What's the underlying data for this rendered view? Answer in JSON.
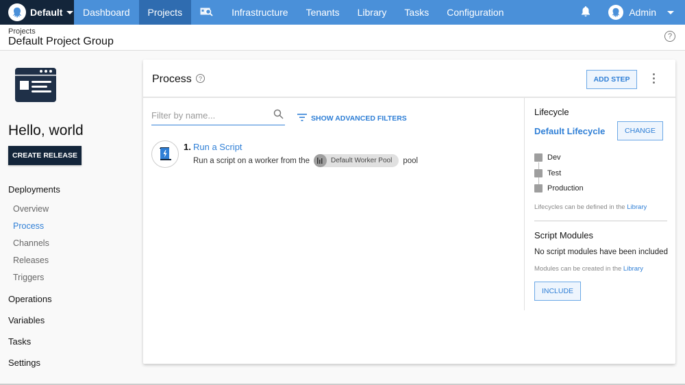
{
  "topnav": {
    "space": "Default",
    "items": [
      "Dashboard",
      "Projects",
      "Infrastructure",
      "Tenants",
      "Library",
      "Tasks",
      "Configuration"
    ],
    "active": "Projects",
    "user": "Admin"
  },
  "header": {
    "breadcrumb": "Projects",
    "title": "Default Project Group"
  },
  "sidebar": {
    "project_name": "Hello, world",
    "create_release": "CREATE RELEASE",
    "groups": {
      "deployments": "Deployments",
      "operations": "Operations",
      "variables": "Variables",
      "tasks": "Tasks",
      "settings": "Settings"
    },
    "deployment_items": [
      "Overview",
      "Process",
      "Channels",
      "Releases",
      "Triggers"
    ],
    "active_item": "Process"
  },
  "process": {
    "title": "Process",
    "add_step": "ADD STEP",
    "filter_placeholder": "Filter by name...",
    "filter_value": "",
    "advanced_filters": "SHOW ADVANCED FILTERS",
    "steps": [
      {
        "number": "1.",
        "name": "Run a Script",
        "desc_prefix": "Run a script on a worker from the",
        "pool": "Default Worker Pool",
        "desc_suffix": "pool"
      }
    ]
  },
  "lifecycle": {
    "title": "Lifecycle",
    "name": "Default Lifecycle",
    "change": "CHANGE",
    "phases": [
      "Dev",
      "Test",
      "Production"
    ],
    "note_prefix": "Lifecycles can be defined in the",
    "note_link": "Library"
  },
  "script_modules": {
    "title": "Script Modules",
    "empty": "No script modules have been included",
    "note_prefix": "Modules can be created in the",
    "note_link": "Library",
    "include": "INCLUDE"
  }
}
